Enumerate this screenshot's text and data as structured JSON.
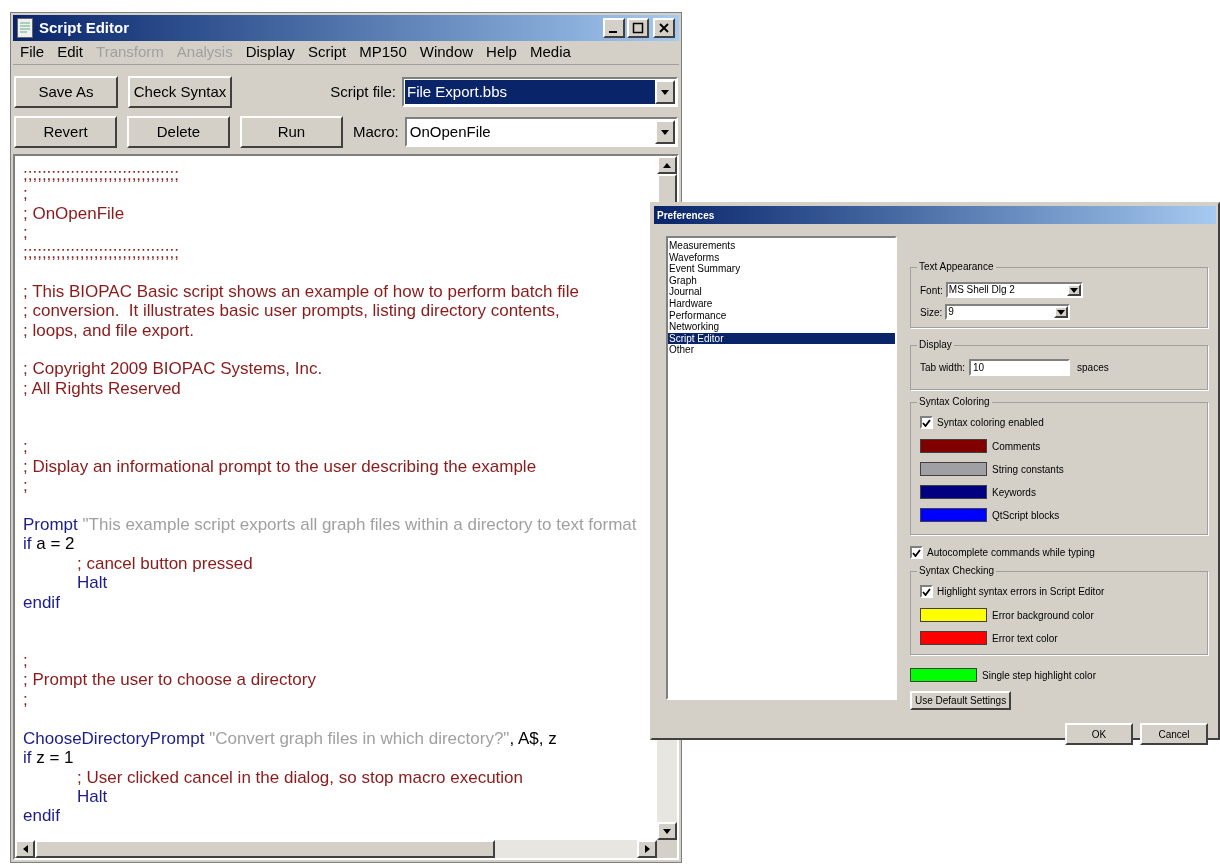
{
  "editor_window": {
    "title": "Script Editor",
    "menu": [
      {
        "label": "File",
        "disabled": false
      },
      {
        "label": "Edit",
        "disabled": false
      },
      {
        "label": "Transform",
        "disabled": true
      },
      {
        "label": "Analysis",
        "disabled": true
      },
      {
        "label": "Display",
        "disabled": false
      },
      {
        "label": "Script",
        "disabled": false
      },
      {
        "label": "MP150",
        "disabled": false
      },
      {
        "label": "Window",
        "disabled": false
      },
      {
        "label": "Help",
        "disabled": false
      },
      {
        "label": "Media",
        "disabled": false
      }
    ],
    "toolbar_rows": [
      {
        "buttons": [
          "Save As",
          "Check Syntax"
        ],
        "label": "Script file:",
        "combo": {
          "value": "File Export.bbs",
          "focused": true
        }
      },
      {
        "buttons": [
          "Revert",
          "Delete",
          "Run"
        ],
        "label": "Macro:",
        "combo": {
          "value": "OnOpenFile",
          "focused": false
        }
      }
    ],
    "code_lines": [
      {
        "segments": [
          {
            "kind": "comment",
            "text": ";;;;;;;;;;;;;;;;;;;;;;;;;;;;;;;;;"
          }
        ]
      },
      {
        "segments": [
          {
            "kind": "comment",
            "text": ";"
          }
        ]
      },
      {
        "segments": [
          {
            "kind": "comment",
            "text": "; OnOpenFile"
          }
        ]
      },
      {
        "segments": [
          {
            "kind": "comment",
            "text": ";"
          }
        ]
      },
      {
        "segments": [
          {
            "kind": "comment",
            "text": ";;;;;;;;;;;;;;;;;;;;;;;;;;;;;;;;;"
          }
        ]
      },
      {
        "kind": "blank"
      },
      {
        "segments": [
          {
            "kind": "comment",
            "text": "; This BIOPAC Basic script shows an example of how to perform batch file"
          }
        ]
      },
      {
        "segments": [
          {
            "kind": "comment",
            "text": "; conversion.  It illustrates basic user prompts, listing directory contents,"
          }
        ]
      },
      {
        "segments": [
          {
            "kind": "comment",
            "text": "; loops, and file export."
          }
        ]
      },
      {
        "kind": "blank"
      },
      {
        "segments": [
          {
            "kind": "comment",
            "text": "; Copyright 2009 BIOPAC Systems, Inc."
          }
        ]
      },
      {
        "segments": [
          {
            "kind": "comment",
            "text": "; All Rights Reserved"
          }
        ]
      },
      {
        "kind": "blank"
      },
      {
        "kind": "blank"
      },
      {
        "segments": [
          {
            "kind": "comment",
            "text": ";"
          }
        ]
      },
      {
        "segments": [
          {
            "kind": "comment",
            "text": "; Display an informational prompt to the user describing the example"
          }
        ]
      },
      {
        "segments": [
          {
            "kind": "comment",
            "text": ";"
          }
        ]
      },
      {
        "kind": "blank"
      },
      {
        "segments": [
          {
            "kind": "keyword",
            "text": "Prompt"
          },
          {
            "kind": "string",
            "text": " \"This example script exports all graph files within a directory to text format"
          }
        ]
      },
      {
        "segments": [
          {
            "kind": "keyword",
            "text": "if"
          },
          {
            "kind": "plain",
            "text": " a = 2"
          }
        ]
      },
      {
        "segments": [
          {
            "kind": "comment",
            "text": "\t; cancel button pressed"
          }
        ]
      },
      {
        "segments": [
          {
            "kind": "keyword",
            "text": "\tHalt"
          }
        ]
      },
      {
        "segments": [
          {
            "kind": "keyword",
            "text": "endif"
          }
        ]
      },
      {
        "kind": "blank"
      },
      {
        "kind": "blank"
      },
      {
        "segments": [
          {
            "kind": "comment",
            "text": ";"
          }
        ]
      },
      {
        "segments": [
          {
            "kind": "comment",
            "text": "; Prompt the user to choose a directory"
          }
        ]
      },
      {
        "segments": [
          {
            "kind": "comment",
            "text": ";"
          }
        ]
      },
      {
        "kind": "blank"
      },
      {
        "segments": [
          {
            "kind": "keyword",
            "text": "ChooseDirectoryPrompt"
          },
          {
            "kind": "string",
            "text": " \"Convert graph files in which directory?\""
          },
          {
            "kind": "plain",
            "text": ", A$, z"
          }
        ]
      },
      {
        "segments": [
          {
            "kind": "keyword",
            "text": "if"
          },
          {
            "kind": "plain",
            "text": " z = 1"
          }
        ]
      },
      {
        "segments": [
          {
            "kind": "comment",
            "text": "\t; User clicked cancel in the dialog, so stop macro execution"
          }
        ]
      },
      {
        "segments": [
          {
            "kind": "keyword",
            "text": "\tHalt"
          }
        ]
      },
      {
        "segments": [
          {
            "kind": "keyword",
            "text": "endif"
          }
        ]
      }
    ]
  },
  "preferences_dialog": {
    "title": "Preferences",
    "categories": [
      {
        "label": "Measurements",
        "selected": false
      },
      {
        "label": "Waveforms",
        "selected": false
      },
      {
        "label": "Event Summary",
        "selected": false
      },
      {
        "label": "Graph",
        "selected": false
      },
      {
        "label": "Journal",
        "selected": false
      },
      {
        "label": "Hardware",
        "selected": false
      },
      {
        "label": "Performance",
        "selected": false
      },
      {
        "label": "Networking",
        "selected": false
      },
      {
        "label": "Script Editor",
        "selected": true
      },
      {
        "label": "Other",
        "selected": false
      }
    ],
    "text_appearance": {
      "title": "Text Appearance",
      "fields": [
        {
          "label": "Font:",
          "value": "MS Shell Dlg 2"
        },
        {
          "label": "Size:",
          "value": "9"
        }
      ]
    },
    "display": {
      "title": "Display",
      "label": "Tab width:",
      "value": "10",
      "suffix": "spaces"
    },
    "syntax_coloring": {
      "title": "Syntax Coloring",
      "checkbox": {
        "label": "Syntax coloring enabled",
        "checked": true
      },
      "colors": [
        {
          "label": "Comments",
          "color": "#800000"
        },
        {
          "label": "String constants",
          "color": "#a0a0a4"
        },
        {
          "label": "Keywords",
          "color": "#000080"
        },
        {
          "label": "QtScript blocks",
          "color": "#0000ff"
        }
      ]
    },
    "autocomplete": {
      "label": "Autocomplete commands while typing",
      "checked": true
    },
    "syntax_checking": {
      "title": "Syntax Checking",
      "checkbox": {
        "label": "Highlight syntax errors in Script Editor",
        "checked": true
      },
      "colors": [
        {
          "label": "Error background color",
          "color": "#ffff00"
        },
        {
          "label": "Error text color",
          "color": "#ff0000"
        }
      ]
    },
    "single_step": {
      "label": "Single step highlight color",
      "color": "#00ff00"
    },
    "default_button": "Use Default Settings",
    "buttons": [
      "OK",
      "Cancel"
    ]
  }
}
